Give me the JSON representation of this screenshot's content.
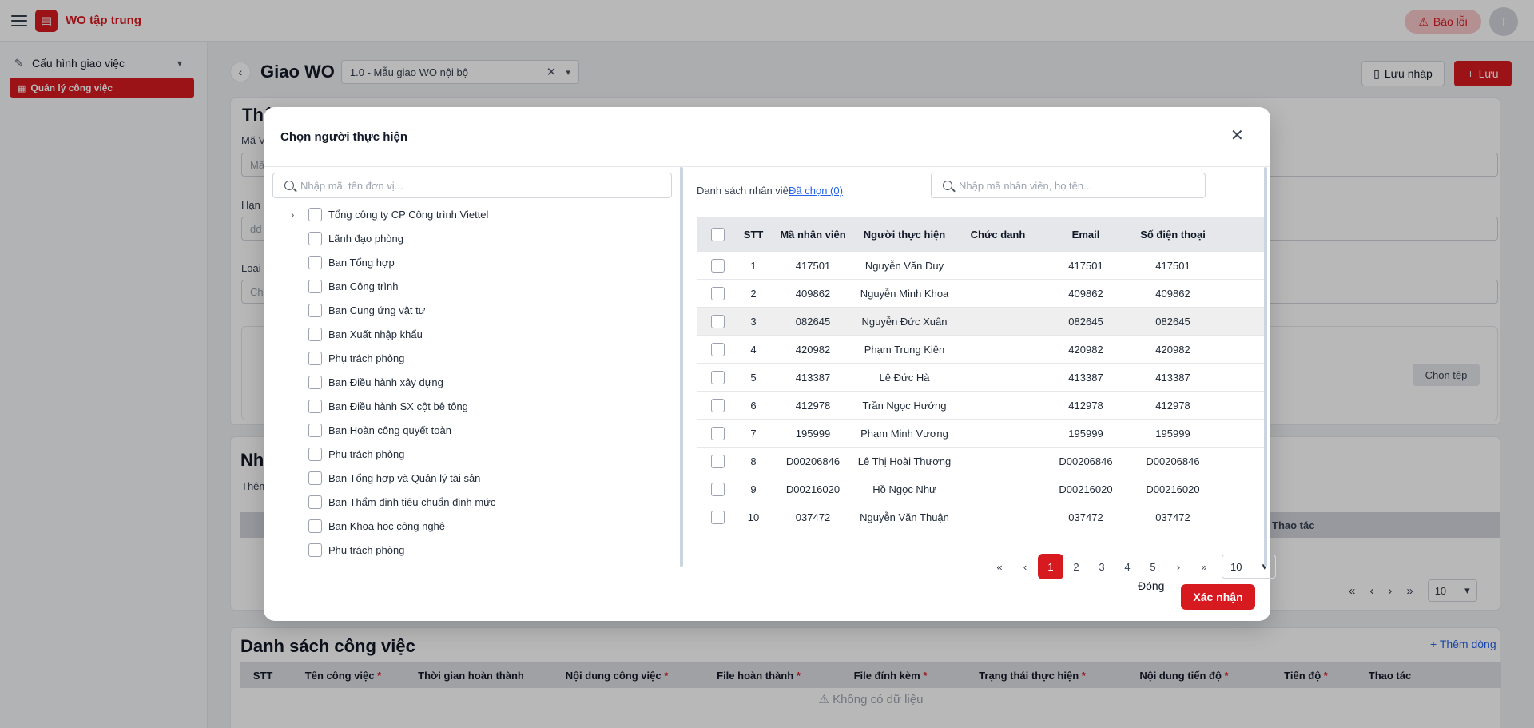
{
  "app": {
    "name": "WO tập trung",
    "report_label": "Báo lỗi",
    "avatar_initial": "T"
  },
  "sidebar": {
    "group_label": "Cấu hình giao việc",
    "active_item": "Quản lý công việc"
  },
  "page": {
    "title": "Giao WO",
    "template_value": "1.0 - Mẫu giao WO nội bộ",
    "draft_label": "Lưu nháp",
    "save_label": "Lưu",
    "pick_file_label": "Chọn tệp",
    "info_card_title_fragment": "Thô",
    "label_ma": "Mã V",
    "label_han": "Hạn",
    "label_loai": "Loại",
    "input_ma_fragment": "Mã",
    "input_han_fragment": "dd",
    "input_loai_fragment": "Ch",
    "people_card_title_fragment": "Nh",
    "people_card_desc_fragment": "Thêm",
    "people_card_action_header": "Thao tác",
    "people_card_page_size": "10"
  },
  "tasks": {
    "title": "Danh sách công việc",
    "add_row_label": "+ Thêm dòng",
    "columns": [
      {
        "label": "STT",
        "required": false
      },
      {
        "label": "Tên công việc",
        "required": true
      },
      {
        "label": "Thời gian hoàn thành",
        "required": false
      },
      {
        "label": "Nội dung công việc",
        "required": true
      },
      {
        "label": "File hoàn thành",
        "required": true
      },
      {
        "label": "File đính kèm",
        "required": true
      },
      {
        "label": "Trạng thái thực hiện",
        "required": true
      },
      {
        "label": "Nội dung tiến độ",
        "required": true
      },
      {
        "label": "Tiến độ",
        "required": true
      },
      {
        "label": "Thao tác",
        "required": false
      }
    ],
    "empty_text": "⚠ Không có dữ liệu"
  },
  "modal": {
    "title": "Chọn người thực hiện",
    "tree_search_placeholder": "Nhập mã, tên đơn vị...",
    "tree_items": [
      "Tổng công ty CP Công trình Viettel",
      "Lãnh đạo phòng",
      "Ban Tổng hợp",
      "Ban Công trình",
      "Ban Cung ứng vật tư",
      "Ban Xuất nhập khẩu",
      "Phụ trách phòng",
      "Ban Điều hành xây dựng",
      "Ban Điều hành SX cột bê tông",
      "Ban Hoàn công quyết toàn",
      "Phụ trách phòng",
      "Ban Tổng hợp và Quản lý tài sản",
      "Ban Thẩm định tiêu chuẩn định mức",
      "Ban Khoa học công nghệ",
      "Phụ trách phòng"
    ],
    "employee_list_label": "Danh sách nhân viên",
    "selected_link": "Đã chọn (0)",
    "employee_search_placeholder": "Nhập mã nhân viên, họ tên...",
    "columns": [
      "STT",
      "Mã nhân viên",
      "Người thực hiện",
      "Chức danh",
      "Email",
      "Số điện thoại"
    ],
    "rows": [
      {
        "stt": "1",
        "code": "417501",
        "name": "Nguyễn Văn Duy",
        "title": "",
        "email": "417501",
        "phone": "417501"
      },
      {
        "stt": "2",
        "code": "409862",
        "name": "Nguyễn Minh Khoa",
        "title": "",
        "email": "409862",
        "phone": "409862"
      },
      {
        "stt": "3",
        "code": "082645",
        "name": "Nguyễn Đức Xuân",
        "title": "",
        "email": "082645",
        "phone": "082645"
      },
      {
        "stt": "4",
        "code": "420982",
        "name": "Phạm Trung Kiên",
        "title": "",
        "email": "420982",
        "phone": "420982"
      },
      {
        "stt": "5",
        "code": "413387",
        "name": "Lê Đức Hà",
        "title": "",
        "email": "413387",
        "phone": "413387"
      },
      {
        "stt": "6",
        "code": "412978",
        "name": "Trần Ngọc Hướng",
        "title": "",
        "email": "412978",
        "phone": "412978"
      },
      {
        "stt": "7",
        "code": "195999",
        "name": "Phạm Minh Vương",
        "title": "",
        "email": "195999",
        "phone": "195999"
      },
      {
        "stt": "8",
        "code": "D00206846",
        "name": "Lê Thị Hoài Thương",
        "title": "",
        "email": "D00206846",
        "phone": "D00206846"
      },
      {
        "stt": "9",
        "code": "D00216020",
        "name": "Hồ Ngọc Như",
        "title": "",
        "email": "D00216020",
        "phone": "D00216020"
      },
      {
        "stt": "10",
        "code": "037472",
        "name": "Nguyễn Văn Thuận",
        "title": "",
        "email": "037472",
        "phone": "037472"
      }
    ],
    "pagination": {
      "pages": [
        "1",
        "2",
        "3",
        "4",
        "5"
      ],
      "current": "1",
      "page_size": "10"
    },
    "close_label": "Đóng",
    "confirm_label": "Xác nhận"
  },
  "colors": {
    "brand": "#d71920",
    "link": "#2563eb"
  }
}
